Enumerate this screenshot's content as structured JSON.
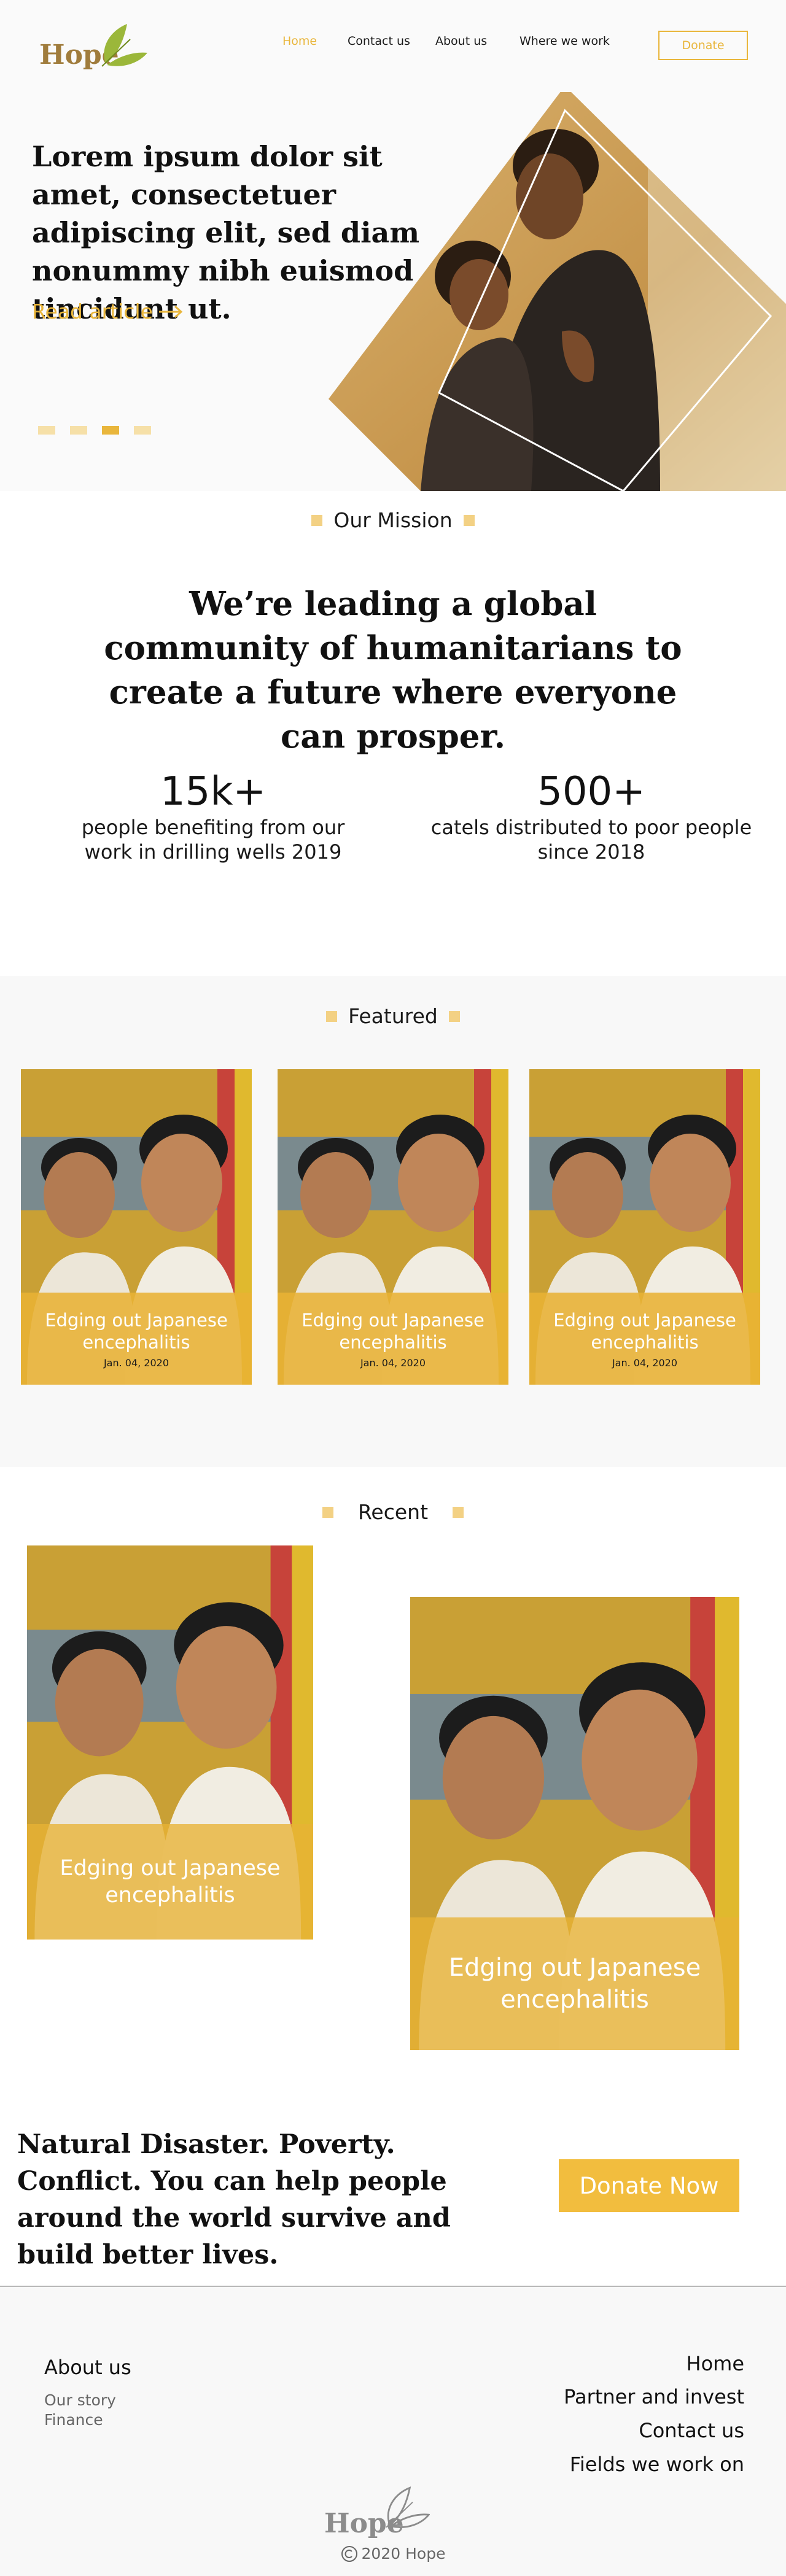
{
  "brand": {
    "logo": "Hope",
    "accent": "#e9b63c",
    "leaf_color": "#9bb73a"
  },
  "nav": {
    "items": [
      "Home",
      "Contact us",
      "About us",
      "Where we work"
    ],
    "active": "Home",
    "donate": "Donate"
  },
  "hero": {
    "title": "Lorem ipsum dolor sit amet, consectetuer adipiscing elit, sed diam nonummy nibh euismod tincidunt ut.",
    "link": "Read article",
    "slides": 4,
    "active_slide": 3
  },
  "mission": {
    "heading": "Our Mission",
    "statement": "We’re leading a global community of humanitarians to create a future where everyone can prosper.",
    "stats": [
      {
        "value": "15k+",
        "text": "people benefiting from our work in drilling wells 2019"
      },
      {
        "value": "500+",
        "text": "catels distributed to poor people since 2018"
      }
    ]
  },
  "featured": {
    "heading": "Featured",
    "cards": [
      {
        "title": "Edging out Japanese encephalitis",
        "date": "Jan. 04, 2020"
      },
      {
        "title": "Edging out Japanese encephalitis",
        "date": "Jan. 04, 2020"
      },
      {
        "title": "Edging out Japanese encephalitis",
        "date": "Jan. 04, 2020"
      }
    ]
  },
  "recent": {
    "heading": "Recent",
    "cards": [
      {
        "title": "Edging out Japanese encephalitis"
      },
      {
        "title": "Edging out Japanese encephalitis"
      }
    ]
  },
  "cta": {
    "text": "Natural Disaster. Poverty. Conflict. You can help people around the world survive and build better lives.",
    "button": "Donate Now"
  },
  "footer": {
    "about_heading": "About us",
    "about_links": [
      "Our story",
      "Finance"
    ],
    "right_links": [
      "Home",
      "Partner and invest",
      "Contact us",
      "Fields we work on"
    ],
    "logo": "Hope",
    "copyright": "2020 Hope"
  }
}
